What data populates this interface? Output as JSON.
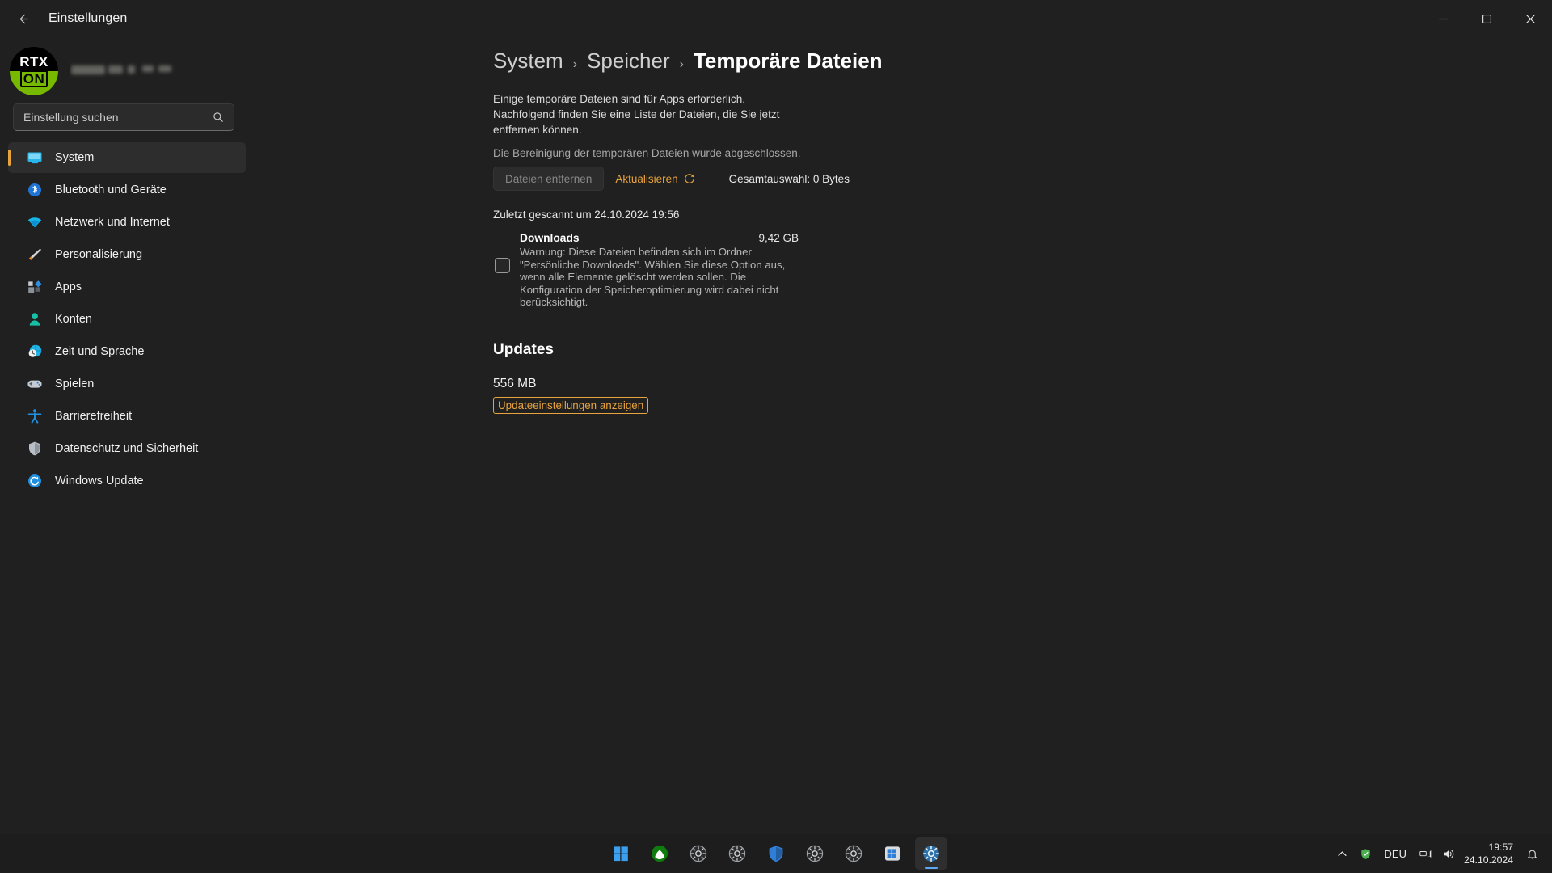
{
  "titlebar": {
    "back_icon": "back-arrow-icon",
    "title": "Einstellungen",
    "minimize_icon": "minimize-icon",
    "maximize_icon": "maximize-icon",
    "close_icon": "close-icon"
  },
  "account": {
    "avatar_top": "RTX",
    "avatar_bottom": "ON",
    "name_blurred": ""
  },
  "search": {
    "placeholder": "Einstellung suchen",
    "value": "",
    "icon": "search-icon"
  },
  "sidebar": {
    "items": [
      {
        "label": "System",
        "icon": "monitor-icon",
        "active": true
      },
      {
        "label": "Bluetooth und Geräte",
        "icon": "bluetooth-icon",
        "active": false
      },
      {
        "label": "Netzwerk und Internet",
        "icon": "wifi-icon",
        "active": false
      },
      {
        "label": "Personalisierung",
        "icon": "paintbrush-icon",
        "active": false
      },
      {
        "label": "Apps",
        "icon": "apps-icon",
        "active": false
      },
      {
        "label": "Konten",
        "icon": "user-icon",
        "active": false
      },
      {
        "label": "Zeit und Sprache",
        "icon": "clock-globe-icon",
        "active": false
      },
      {
        "label": "Spielen",
        "icon": "gamepad-icon",
        "active": false
      },
      {
        "label": "Barrierefreiheit",
        "icon": "accessibility-icon",
        "active": false
      },
      {
        "label": "Datenschutz und Sicherheit",
        "icon": "shield-icon",
        "active": false
      },
      {
        "label": "Windows Update",
        "icon": "update-icon",
        "active": false
      }
    ]
  },
  "breadcrumb": {
    "level1": "System",
    "sep1": "›",
    "level2": "Speicher",
    "sep2": "›",
    "current": "Temporäre Dateien"
  },
  "content": {
    "description": "Einige temporäre Dateien sind für Apps erforderlich. Nachfolgend finden Sie eine Liste der Dateien, die Sie jetzt entfernen können.",
    "status_note": "Die Bereinigung der temporären Dateien wurde abgeschlossen.",
    "remove_button": "Dateien entfernen",
    "refresh_button": "Aktualisieren",
    "refresh_icon": "refresh-icon",
    "total_selection": "Gesamtauswahl: 0 Bytes",
    "last_scan": "Zuletzt gescannt um 24.10.2024 19:56",
    "entries": [
      {
        "title": "Downloads",
        "size": "9,42 GB",
        "checked": false,
        "warning": "Warnung: Diese Dateien befinden sich im Ordner \"Persönliche Downloads\". Wählen Sie diese Option aus, wenn alle Elemente gelöscht werden sollen. Die Konfiguration der Speicheroptimierung wird dabei nicht berücksichtigt."
      }
    ],
    "updates_section": {
      "title": "Updates",
      "size": "556 MB",
      "link": "Updateeinstellungen anzeigen"
    }
  },
  "taskbar": {
    "buttons": [
      {
        "name": "start-button",
        "icon": "windows-logo-icon"
      },
      {
        "name": "xbox-button",
        "icon": "xbox-icon"
      },
      {
        "name": "app-button-1",
        "icon": "circle-gear-icon"
      },
      {
        "name": "app-button-2",
        "icon": "circle-gear-icon"
      },
      {
        "name": "security-button",
        "icon": "shield-blue-icon"
      },
      {
        "name": "app-button-3",
        "icon": "circle-gear-icon"
      },
      {
        "name": "app-button-4",
        "icon": "circle-gear-icon"
      },
      {
        "name": "store-button",
        "icon": "store-icon"
      },
      {
        "name": "settings-button",
        "icon": "settings-gear-icon"
      }
    ],
    "tray": {
      "chevron_icon": "chevron-up-icon",
      "shield_icon": "green-shield-icon",
      "language": "DEU",
      "network_icon": "network-icon",
      "volume_icon": "volume-icon",
      "time": "19:57",
      "date": "24.10.2024",
      "notification_icon": "bell-icon"
    }
  },
  "colors": {
    "accent": "#e8a33d",
    "background": "#202020",
    "taskbar": "#1d1d1d",
    "nvidia_green": "#76b900"
  }
}
